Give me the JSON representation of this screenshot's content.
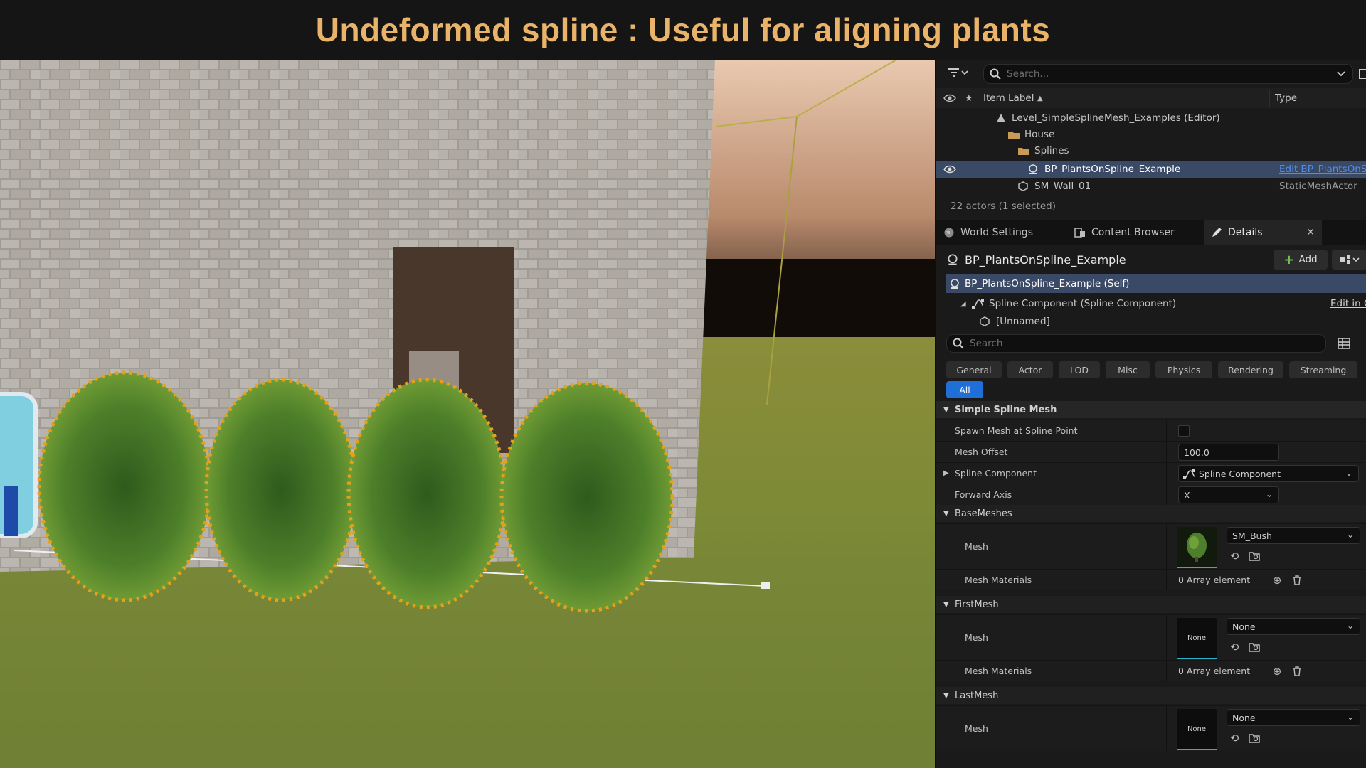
{
  "banner": {
    "title": "Undeformed spline : Useful for aligning plants"
  },
  "outliner": {
    "search_placeholder": "Search...",
    "col_item_label": "Item Label",
    "col_type": "Type",
    "items": [
      {
        "label": "Level_SimpleSplineMesh_Examples (Editor)",
        "type": ""
      },
      {
        "label": "House",
        "type": ""
      },
      {
        "label": "Splines",
        "type": ""
      },
      {
        "label": "BP_PlantsOnSpline_Example",
        "type": "Edit BP_PlantsOnS"
      },
      {
        "label": "SM_Wall_01",
        "type": "StaticMeshActor"
      }
    ],
    "status": "22 actors (1 selected)"
  },
  "tabs": [
    {
      "label": "World Settings"
    },
    {
      "label": "Content Browser"
    },
    {
      "label": "Details"
    }
  ],
  "details": {
    "actor_name": "BP_PlantsOnSpline_Example",
    "add_label": "Add",
    "components": [
      {
        "label": "BP_PlantsOnSpline_Example (Self)"
      },
      {
        "label": "Spline Component (Spline Component)",
        "action": "Edit in C"
      },
      {
        "label": "[Unnamed]"
      }
    ],
    "search_placeholder": "Search",
    "categories": [
      "General",
      "Actor",
      "LOD",
      "Misc",
      "Physics",
      "Rendering",
      "Streaming",
      "All"
    ],
    "sections": {
      "simple_spline_mesh": "Simple Spline Mesh",
      "base_meshes": "BaseMeshes",
      "first_mesh": "FirstMesh",
      "last_mesh": "LastMesh"
    },
    "props": {
      "spawn_mesh": "Spawn Mesh at Spline Point",
      "mesh_offset": "Mesh Offset",
      "mesh_offset_value": "100.0",
      "spline_component": "Spline Component",
      "spline_component_value": "Spline Component",
      "forward_axis": "Forward Axis",
      "forward_axis_value": "X",
      "mesh": "Mesh",
      "mesh_materials": "Mesh Materials",
      "base_mesh_value": "SM_Bush",
      "array_elements": "0 Array element",
      "none": "None",
      "thumb_none": "None"
    }
  },
  "colors": {
    "banner_text": "#e9b46a",
    "selection": "#3a4a66",
    "accent_blue": "#1f6fd6",
    "thumb_underline": "#26b3c7",
    "plant_highlight": "#e3a21a"
  }
}
